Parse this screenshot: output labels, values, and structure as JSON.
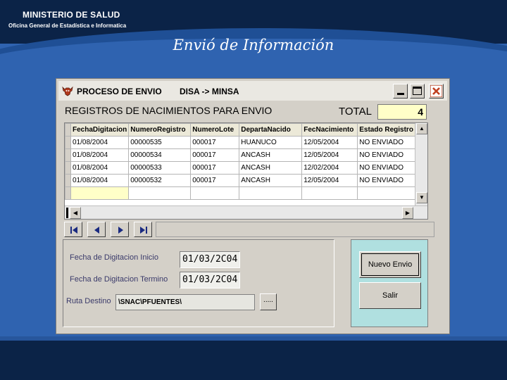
{
  "slide": {
    "org_name": "MINISTERIO DE SALUD",
    "org_sub": "Oficina General de Estadística e Informatica",
    "title": "Envió de Información",
    "colors": {
      "background": "#2f63b0",
      "band": "#0b2347"
    }
  },
  "window": {
    "title_left": "PROCESO DE ENVIO",
    "title_right": "DISA -> MINSA",
    "icons": {
      "app": "bull-icon",
      "minimize": "minimize-icon",
      "maximize": "maximize-icon",
      "close": "close-icon"
    }
  },
  "grid": {
    "heading": "REGISTROS DE NACIMIENTOS PARA ENVIO",
    "total_label": "TOTAL",
    "total_value": "4",
    "columns": [
      "FechaDigitacion",
      "NumeroRegistro",
      "NumeroLote",
      "DepartaNacido",
      "FecNacimiento",
      "Estado Registro"
    ],
    "rows": [
      [
        "01/08/2004",
        "00000535",
        "000017",
        "HUANUCO",
        "12/05/2004",
        "NO ENVIADO"
      ],
      [
        "01/08/2004",
        "00000534",
        "000017",
        "ANCASH",
        "12/05/2004",
        "NO ENVIADO"
      ],
      [
        "01/08/2004",
        "00000533",
        "000017",
        "ANCASH",
        "12/02/2004",
        "NO ENVIADO"
      ],
      [
        "01/08/2004",
        "00000532",
        "000017",
        "ANCASH",
        "12/05/2004",
        "NO ENVIADO"
      ]
    ]
  },
  "navigator": {
    "icons": [
      "first-record-icon",
      "prev-record-icon",
      "next-record-icon",
      "last-record-icon"
    ]
  },
  "form": {
    "fecha_inicio_label": "Fecha de Digitacion Inicio",
    "fecha_inicio_value": "01/03/2C04",
    "fecha_termino_label": "Fecha de Digitacion Termino",
    "fecha_termino_value": "01/03/2C04",
    "ruta_label": "Ruta Destino",
    "ruta_value": "\\SNAC\\PFUENTES\\",
    "browse_label": "....."
  },
  "actions": {
    "nuevo_envio": "Nuevo Envio",
    "salir": "Salir"
  }
}
